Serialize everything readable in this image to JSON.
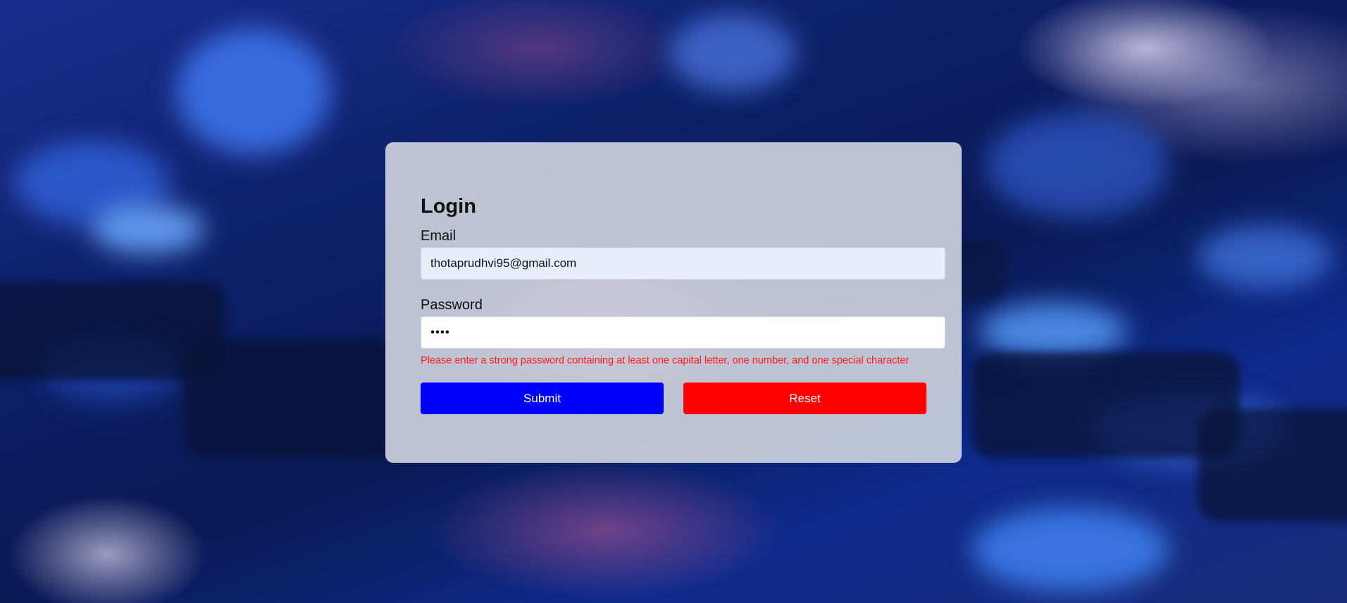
{
  "form": {
    "title": "Login",
    "email": {
      "label": "Email",
      "value": "thotaprudhvi95@gmail.com"
    },
    "password": {
      "label": "Password",
      "value": "1234"
    },
    "error_message": "Please enter a strong password containing at least one capital letter, one number, and one special character",
    "buttons": {
      "submit_label": "Submit",
      "reset_label": "Reset"
    }
  },
  "colors": {
    "submit": "#0000ff",
    "reset": "#ff0000",
    "error": "#ff1a1a",
    "card": "#dcdee6"
  }
}
